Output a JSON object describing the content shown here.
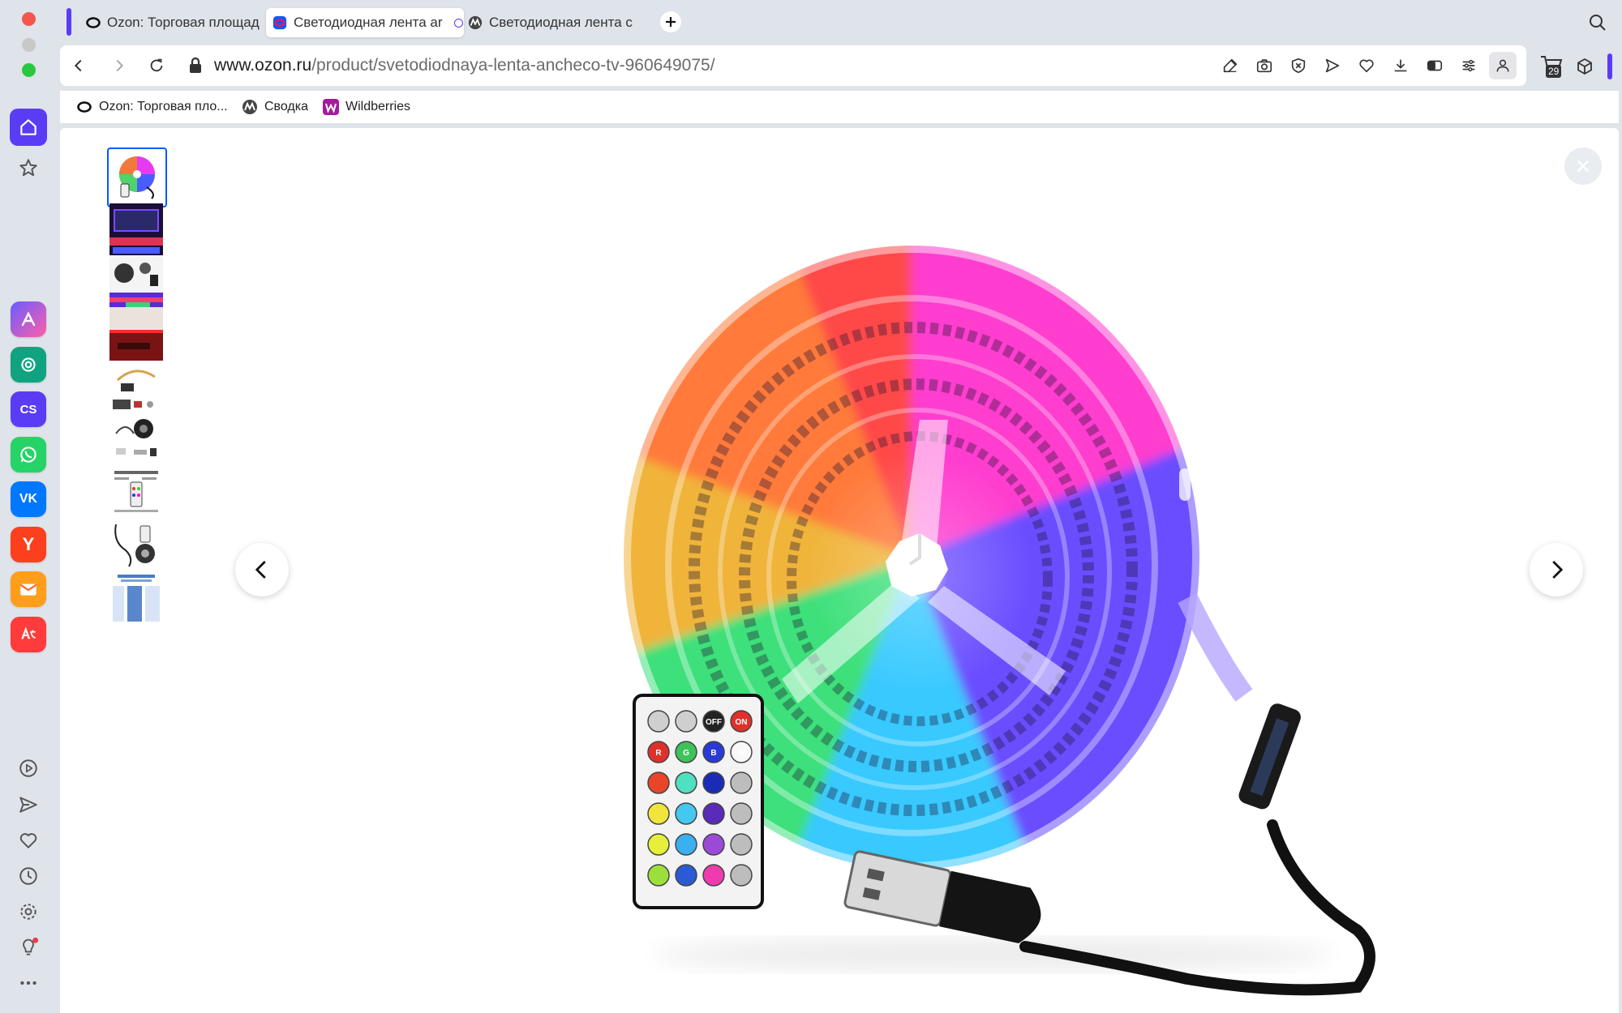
{
  "browser": {
    "tabs": [
      {
        "label": "Ozon: Торговая площад",
        "icon": "ozon-logo"
      },
      {
        "label": "Светодиодная лента ar",
        "icon": "ozon-cart-logo",
        "active": true
      },
      {
        "label": "Светодиодная лента с",
        "icon": "mpstats-logo"
      }
    ],
    "new_tab_icon": "plus-icon",
    "search_icon": "search-icon",
    "address": {
      "host": "www.ozon.ru",
      "path": "/product/svetodiodnaya-lenta-ancheco-tv-960649075/"
    },
    "toolbar_icons": [
      "edit-icon",
      "camera-icon",
      "shield-icon",
      "send-icon",
      "heart-icon",
      "download-icon",
      "toggle-icon",
      "sliders-icon",
      "profile-icon",
      "cart-icon",
      "box-icon"
    ],
    "cart_count": "29",
    "bookmarks": [
      {
        "label": "Ozon: Торговая пло...",
        "icon": "ozon-logo"
      },
      {
        "label": "Сводка",
        "icon": "mpstats-logo"
      },
      {
        "label": "Wildberries",
        "icon": "wildberries-logo"
      }
    ]
  },
  "sidebar": {
    "apps": [
      "aria-icon",
      "chatgpt-icon",
      "cs-icon",
      "whatsapp-icon",
      "vk-icon",
      "yandex-icon",
      "mail-icon",
      "translate-icon"
    ],
    "cs_label": "CS",
    "vk_label": "VK",
    "yandex_label": "Y",
    "bottom_icons": [
      "player-icon",
      "send-icon",
      "heart-icon",
      "history-icon",
      "settings-icon",
      "bulb-icon",
      "more-icon"
    ]
  },
  "gallery": {
    "thumbnail_count": 9,
    "selected_index": 0,
    "prev_icon": "chevron-left-icon",
    "next_icon": "chevron-right-icon",
    "close_icon": "close-icon",
    "remote_keys": [
      "OFF",
      "ON",
      "W",
      "R",
      "G",
      "B"
    ]
  }
}
